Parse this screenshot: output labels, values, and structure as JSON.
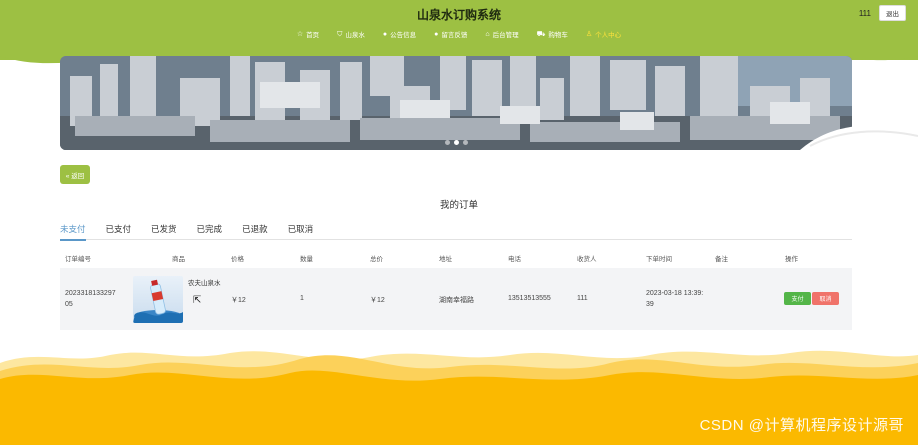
{
  "header": {
    "site_title": "山泉水订购系统",
    "user_name": "111",
    "logout_label": "退出",
    "nav": [
      {
        "icon": "star-icon",
        "glyph": "☆",
        "label": "首页",
        "active": false
      },
      {
        "icon": "bag-icon",
        "glyph": "⛉",
        "label": "山泉水",
        "active": false
      },
      {
        "icon": "info-icon",
        "glyph": "●",
        "label": "公告信息",
        "active": false
      },
      {
        "icon": "feedback-icon",
        "glyph": "●",
        "label": "留言反馈",
        "active": false
      },
      {
        "icon": "admin-icon",
        "glyph": "⌂",
        "label": "后台管理",
        "active": false
      },
      {
        "icon": "cart-icon",
        "glyph": "⛟",
        "label": "购物车",
        "active": false
      },
      {
        "icon": "user-icon",
        "glyph": "♙",
        "label": "个人中心",
        "active": true
      }
    ]
  },
  "banner": {
    "dots": 3,
    "active_dot": 1
  },
  "back_button_label": "« 返回",
  "page_heading": "我的订单",
  "tabs": [
    {
      "label": "未支付",
      "active": true
    },
    {
      "label": "已支付",
      "active": false
    },
    {
      "label": "已发货",
      "active": false
    },
    {
      "label": "已完成",
      "active": false
    },
    {
      "label": "已退款",
      "active": false
    },
    {
      "label": "已取消",
      "active": false
    }
  ],
  "table": {
    "headers": {
      "order_no": "订单编号",
      "product": "商品",
      "price": "价格",
      "quantity": "数量",
      "total": "总价",
      "address": "地址",
      "phone": "电话",
      "recipient": "收货人",
      "order_time": "下单时间",
      "remark": "备注",
      "actions": "操作"
    },
    "rows": [
      {
        "order_no_line1": "2023318133297",
        "order_no_line2": "05",
        "product_name": "农夫山泉水",
        "price": "￥12",
        "quantity": "1",
        "total": "￥12",
        "address": "湖南幸福路",
        "phone": "13513513555",
        "recipient": "111",
        "order_time_line1": "2023-03-18 13:39:",
        "order_time_line2": "39",
        "remark": "",
        "pay_label": "支付",
        "cancel_label": "取消"
      }
    ]
  },
  "watermark": "CSDN @计算机程序设计源哥",
  "colors": {
    "header_green": "#9dc043",
    "active_tab": "#5a97c8",
    "nav_active": "#ffe23b",
    "pay_green": "#53b548",
    "cancel_red": "#f0736a",
    "footer_yellow": "#fbb900"
  }
}
